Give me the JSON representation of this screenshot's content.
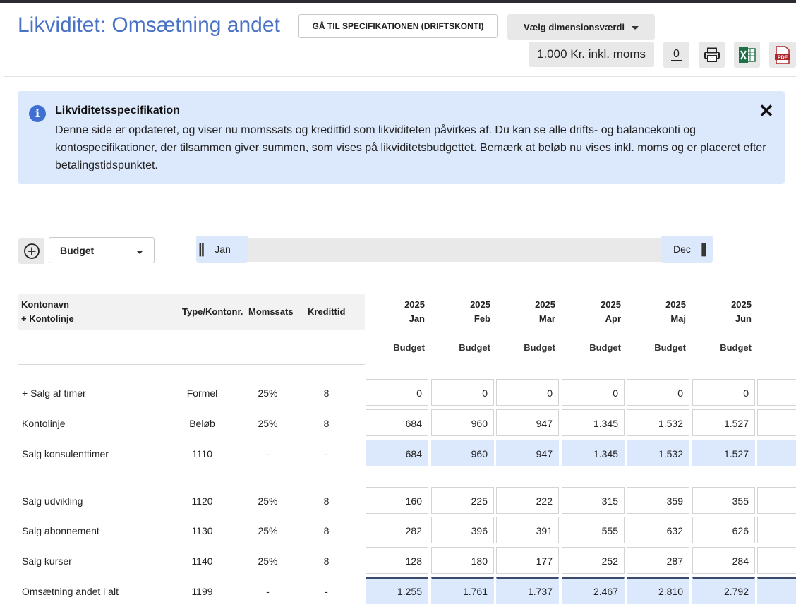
{
  "header": {
    "title": "Likviditet: Omsætning andet",
    "spec_button": "GÅ TIL SPECIFIKATIONEN (DRIFTSKONTI)",
    "dimension_button": "Vælg dimensionsværdi",
    "unit_button": "1.000 Kr. inkl. moms",
    "zero_button": "0",
    "icons": [
      "zero-toggle-icon",
      "print-icon",
      "excel-icon",
      "pdf-icon"
    ]
  },
  "info": {
    "title": "Likviditetsspecifikation",
    "text": "Denne side er opdateret, og viser nu momssats og kredittid som likviditeten påvirkes af. Du kan se alle drifts- og balancekonti og kontospecifikationer, der tilsammen giver summen, som vises på likviditetsbudgettet. Bemærk at beløb nu vises inkl. moms og er placeret efter betalingstidspunktet.",
    "close": "✕"
  },
  "controls": {
    "add_icon": "plus-circle-icon",
    "scenario_select": "Budget",
    "range_start": "Jan",
    "range_end": "Dec"
  },
  "table": {
    "headers": {
      "name_line1": "Kontonavn",
      "name_line2": "+ Kontolinje",
      "type": "Type/Kontonr.",
      "moms": "Momssats",
      "kredit": "Kredittid"
    },
    "months": [
      {
        "year": "2025",
        "month": "Jan",
        "sub": "Budget"
      },
      {
        "year": "2025",
        "month": "Feb",
        "sub": "Budget"
      },
      {
        "year": "2025",
        "month": "Mar",
        "sub": "Budget"
      },
      {
        "year": "2025",
        "month": "Apr",
        "sub": "Budget"
      },
      {
        "year": "2025",
        "month": "Maj",
        "sub": "Budget"
      },
      {
        "year": "2025",
        "month": "Jun",
        "sub": "Budget"
      }
    ],
    "rows": [
      {
        "name": "+ Salg af timer",
        "type": "Formel",
        "moms": "25%",
        "kredit": "8",
        "values": [
          "0",
          "0",
          "0",
          "0",
          "0",
          "0"
        ]
      },
      {
        "name": "Kontolinje",
        "type": "Beløb",
        "moms": "25%",
        "kredit": "8",
        "values": [
          "684",
          "960",
          "947",
          "1.345",
          "1.532",
          "1.527"
        ]
      },
      {
        "name": "Salg konsulenttimer",
        "type": "1110",
        "moms": "-",
        "kredit": "-",
        "values": [
          "684",
          "960",
          "947",
          "1.345",
          "1.532",
          "1.527"
        ]
      },
      {
        "name": "Salg udvikling",
        "type": "1120",
        "moms": "25%",
        "kredit": "8",
        "values": [
          "160",
          "225",
          "222",
          "315",
          "359",
          "355"
        ]
      },
      {
        "name": "Salg abonnement",
        "type": "1130",
        "moms": "25%",
        "kredit": "8",
        "values": [
          "282",
          "396",
          "391",
          "555",
          "632",
          "626"
        ]
      },
      {
        "name": "Salg kurser",
        "type": "1140",
        "moms": "25%",
        "kredit": "8",
        "values": [
          "128",
          "180",
          "177",
          "252",
          "287",
          "284"
        ]
      },
      {
        "name": "Omsætning andet i alt",
        "type": "1199",
        "moms": "-",
        "kredit": "-",
        "values": [
          "1.255",
          "1.761",
          "1.737",
          "2.467",
          "2.810",
          "2.792"
        ]
      }
    ]
  }
}
